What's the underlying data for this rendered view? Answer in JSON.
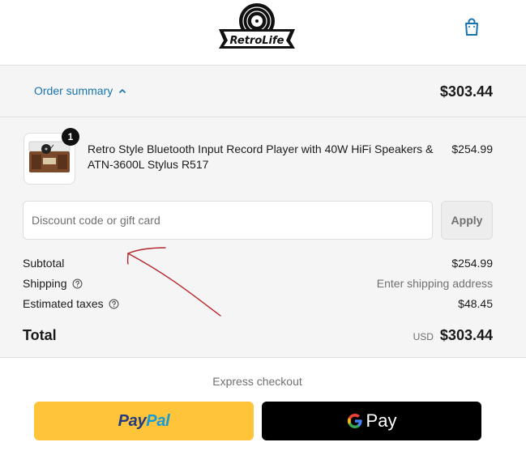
{
  "header": {
    "logo_text": "RETROLIFE",
    "cart_icon": "shopping-bag-icon"
  },
  "summary": {
    "toggle_label": "Order summary",
    "toggle_icon": "chevron-up-icon",
    "total": "$303.44"
  },
  "line_item": {
    "title": "Retro Style Bluetooth Input Record Player with 40W HiFi Speakers & ATN-3600L Stylus R517",
    "quantity": "1",
    "price": "$254.99",
    "image_icon": "record-player-thumbnail"
  },
  "discount": {
    "placeholder": "Discount code or gift card",
    "value": "",
    "apply_label": "Apply"
  },
  "costs": {
    "subtotal_label": "Subtotal",
    "subtotal_value": "$254.99",
    "shipping_label": "Shipping",
    "shipping_value": "Enter shipping address",
    "taxes_label": "Estimated taxes",
    "taxes_value": "$48.45",
    "total_label": "Total",
    "total_currency": "USD",
    "total_value": "$303.44"
  },
  "express": {
    "label": "Express checkout",
    "paypal_part1": "Pay",
    "paypal_part2": "Pal",
    "gpay_label": "Pay"
  },
  "colors": {
    "link_blue": "#1773b0",
    "paypal_yellow": "#ffc439",
    "annotation_red": "#b3262e"
  }
}
